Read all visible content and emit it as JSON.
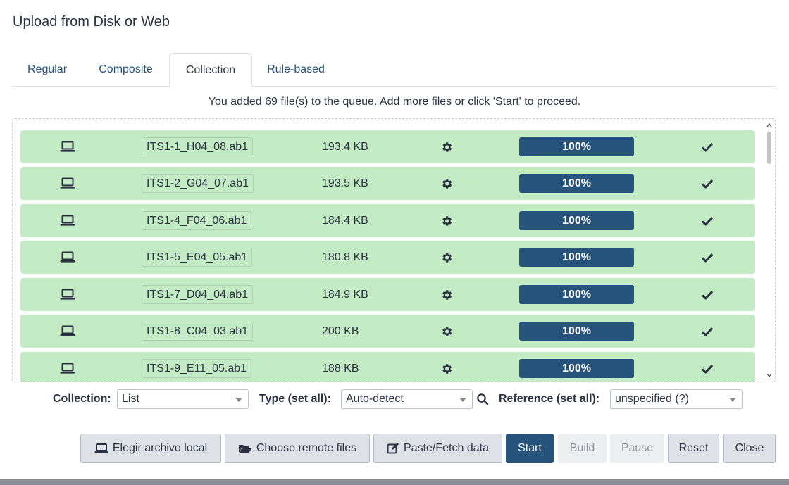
{
  "dialog": {
    "title": "Upload from Disk or Web"
  },
  "tabs": [
    {
      "label": "Regular"
    },
    {
      "label": "Composite"
    },
    {
      "label": "Collection",
      "active": true
    },
    {
      "label": "Rule-based"
    }
  ],
  "helper_text": "You added 69 file(s) to the queue. Add more files or click 'Start' to proceed.",
  "queue": {
    "rows": [
      {
        "source_icon": "laptop-icon",
        "name": "ITS1-1_H04_08.ab1",
        "size": "193.4 KB",
        "progress": 100,
        "progress_label": "100%",
        "status_icon": "check-icon"
      },
      {
        "source_icon": "laptop-icon",
        "name": "ITS1-2_G04_07.ab1",
        "size": "193.5 KB",
        "progress": 100,
        "progress_label": "100%",
        "status_icon": "check-icon"
      },
      {
        "source_icon": "laptop-icon",
        "name": "ITS1-4_F04_06.ab1",
        "size": "184.4 KB",
        "progress": 100,
        "progress_label": "100%",
        "status_icon": "check-icon"
      },
      {
        "source_icon": "laptop-icon",
        "name": "ITS1-5_E04_05.ab1",
        "size": "180.8 KB",
        "progress": 100,
        "progress_label": "100%",
        "status_icon": "check-icon"
      },
      {
        "source_icon": "laptop-icon",
        "name": "ITS1-7_D04_04.ab1",
        "size": "184.9 KB",
        "progress": 100,
        "progress_label": "100%",
        "status_icon": "check-icon"
      },
      {
        "source_icon": "laptop-icon",
        "name": "ITS1-8_C04_03.ab1",
        "size": "200 KB",
        "progress": 100,
        "progress_label": "100%",
        "status_icon": "check-icon"
      },
      {
        "source_icon": "laptop-icon",
        "name": "ITS1-9_E11_05.ab1",
        "size": "188 KB",
        "progress": 100,
        "progress_label": "100%",
        "status_icon": "check-icon"
      }
    ]
  },
  "options": {
    "collection_label": "Collection:",
    "collection_value": "List",
    "type_label": "Type (set all):",
    "type_value": "Auto-detect",
    "reference_label": "Reference (set all):",
    "reference_value": "unspecified (?)"
  },
  "buttons": {
    "local": "Elegir archivo local",
    "remote": "Choose remote files",
    "paste": "Paste/Fetch data",
    "start": "Start",
    "build": "Build",
    "pause": "Pause",
    "reset": "Reset",
    "close": "Close"
  },
  "colors": {
    "row_success": "#c3ecc4",
    "primary": "#25537b",
    "link": "#25537b"
  }
}
